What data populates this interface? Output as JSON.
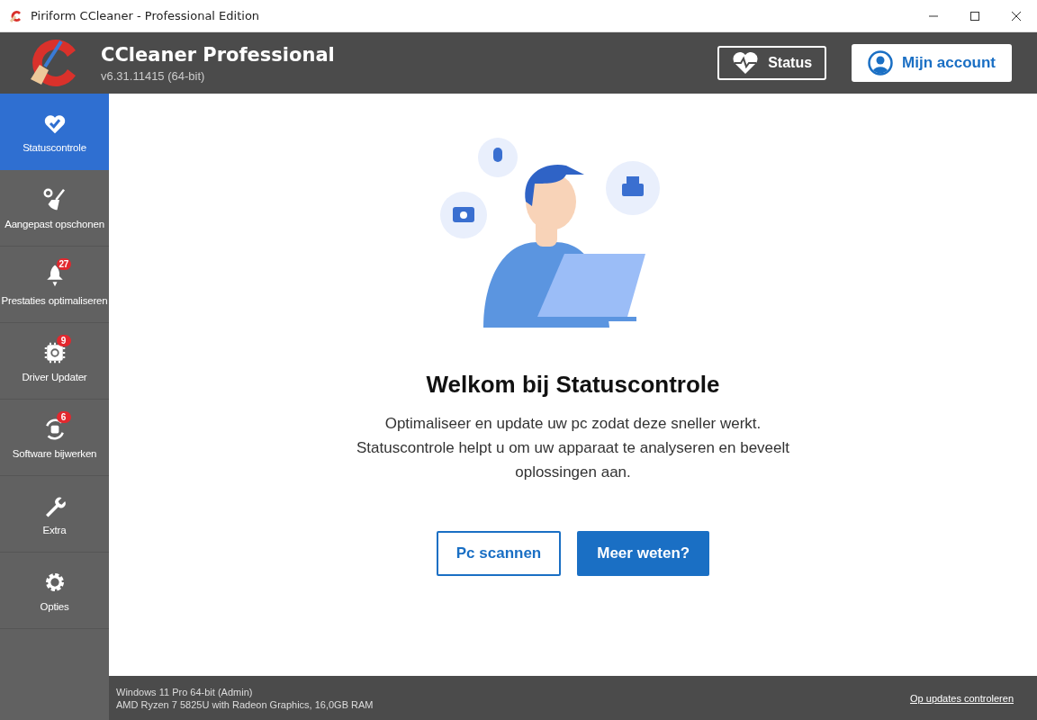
{
  "window": {
    "title": "Piriform CCleaner - Professional Edition"
  },
  "header": {
    "product": "CCleaner Professional",
    "version": "v6.31.11415 (64-bit)",
    "status_button": "Status",
    "account_button": "Mijn account"
  },
  "sidebar": {
    "items": [
      {
        "label": "Statuscontrole",
        "selected": true
      },
      {
        "label": "Aangepast opschonen",
        "selected": false
      },
      {
        "label": "Prestaties optimaliseren",
        "badge": "27",
        "selected": false
      },
      {
        "label": "Driver Updater",
        "badge": "9",
        "selected": false
      },
      {
        "label": "Software bijwerken",
        "badge": "6",
        "selected": false
      },
      {
        "label": "Extra",
        "selected": false
      },
      {
        "label": "Opties",
        "selected": false
      }
    ]
  },
  "main": {
    "heading": "Welkom bij Statuscontrole",
    "description": "Optimaliseer en update uw pc zodat deze sneller werkt. Statuscontrole helpt u om uw apparaat te analyseren en beveelt oplossingen aan.",
    "buttons": [
      {
        "label": "Pc scannen",
        "kind": "outline"
      },
      {
        "label": "Meer weten?",
        "kind": "primary"
      }
    ]
  },
  "status_bar": {
    "lines": [
      "Windows 11 Pro 64-bit (Admin)",
      "AMD Ryzen 7 5825U with Radeon Graphics, 16,0GB RAM"
    ],
    "link": "Op updates controleren"
  }
}
